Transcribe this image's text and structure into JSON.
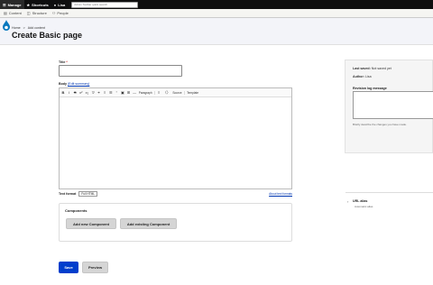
{
  "toolbar": {
    "items": [
      {
        "label": "Manage",
        "icon": "menu-icon"
      },
      {
        "label": "Shortcuts",
        "icon": "star-icon"
      },
      {
        "label": "Lisa",
        "icon": "user-icon"
      }
    ],
    "search_placeholder": "Admin Toolbar quick search"
  },
  "tray": {
    "items": [
      {
        "label": "Content",
        "icon": "content-icon"
      },
      {
        "label": "Structure",
        "icon": "structure-icon"
      },
      {
        "label": "People",
        "icon": "people-icon"
      }
    ]
  },
  "breadcrumb": {
    "home": "Home",
    "sep": ">",
    "add": "Add content"
  },
  "page": {
    "title": "Create Basic page"
  },
  "form": {
    "title_label": "Title",
    "required_mark": "*",
    "body_label": "Body",
    "edit_summary": "(Edit summary)",
    "toolbar": {
      "bold": "B",
      "italic": "I",
      "strike": "S",
      "sup": "x²",
      "sub": "x₂",
      "clear": "T̸",
      "link": "🔗",
      "bullets": "≡",
      "numbers": "☰",
      "blockquote": "”",
      "image": "▣",
      "table": "⊞",
      "hr": "—",
      "heading": "Paragraph",
      "align": "≡",
      "code": "〈〉",
      "source_label": "Source",
      "template_label": "Template"
    },
    "text_format_label": "Text format",
    "text_format_value": "Full HTML",
    "format_help": "About text formats"
  },
  "components": {
    "title": "Components",
    "add_new": "Add new Component",
    "add_existing": "Add existing Component"
  },
  "actions": {
    "save": "Save",
    "preview": "Preview"
  },
  "sidebar": {
    "last_saved_label": "Last saved:",
    "last_saved_value": "Not saved yet",
    "author_label": "Author:",
    "author_value": "Lisa",
    "revision_label": "Revision log message",
    "revision_desc": "Briefly describe the changes you have made.",
    "url_alias_label": "URL alias",
    "url_alias_sub": "Automatic alias"
  }
}
